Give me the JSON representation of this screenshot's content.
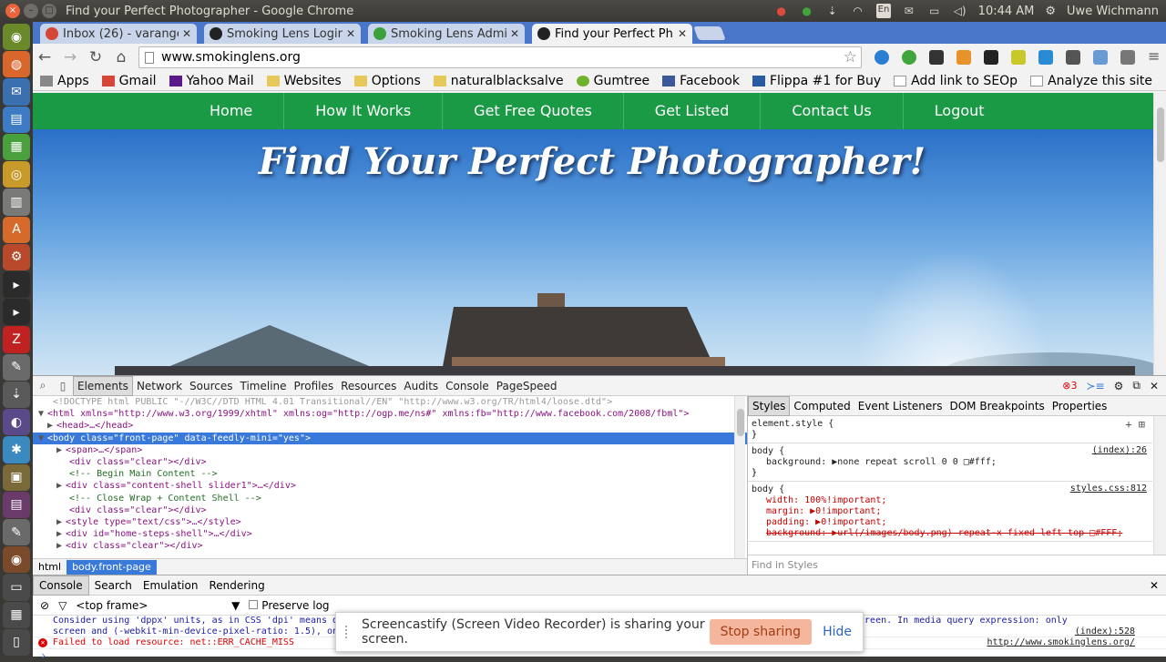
{
  "os": {
    "window_title": "Find your Perfect Photographer - Google Chrome",
    "time": "10:44 AM",
    "user": "Uwe Wichmann",
    "lang": "En"
  },
  "tabs": [
    {
      "label": "Inbox (26) - varange",
      "color": "#d44638"
    },
    {
      "label": "Smoking Lens Login",
      "color": "#222222"
    },
    {
      "label": "Smoking Lens Admi",
      "color": "#3ca03c"
    },
    {
      "label": "Find your Perfect Ph",
      "color": "#222222"
    }
  ],
  "toolbar": {
    "url": "www.smokinglens.org"
  },
  "bookmarks": [
    "Apps",
    "Gmail",
    "Yahoo Mail",
    "Websites",
    "Options",
    "naturalblacksalve",
    "Gumtree",
    "Facebook",
    "Flippa #1 for Buy",
    "Add link to SEOp",
    "Analyze this site"
  ],
  "site": {
    "nav": [
      "Home",
      "How It Works",
      "Get Free Quotes",
      "Get Listed",
      "Contact Us",
      "Logout"
    ],
    "hero_title": "Find Your Perfect Photographer!"
  },
  "devtools": {
    "tabs": [
      "Elements",
      "Network",
      "Sources",
      "Timeline",
      "Profiles",
      "Resources",
      "Audits",
      "Console",
      "PageSpeed"
    ],
    "error_count": "3",
    "dom_lines": [
      {
        "text": "<!DOCTYPE html PUBLIC \"-//W3C//DTD HTML 4.01 Transitional//EN\" \"http://www.w3.org/TR/html4/loose.dtd\">",
        "kind": "doctype",
        "tri": ""
      },
      {
        "text": "<html xmlns=\"http://www.w3.org/1999/xhtml\" xmlns:og=\"http://ogp.me/ns#\" xmlns:fb=\"http://www.facebook.com/2008/fbml\">",
        "kind": "tag",
        "tri": "▼"
      },
      {
        "text": "<head>…</head>",
        "kind": "tag",
        "tri": "▶"
      },
      {
        "text": "<body class=\"front-page\" data-feedly-mini=\"yes\">",
        "kind": "sel",
        "tri": "▼"
      },
      {
        "text": "<span>…</span>",
        "kind": "tag",
        "tri": "▶"
      },
      {
        "text": "<div class=\"clear\"></div>",
        "kind": "tag",
        "tri": ""
      },
      {
        "text": "<!-- Begin Main Content -->",
        "kind": "comment",
        "tri": ""
      },
      {
        "text": "<div class=\"content-shell slider1\">…</div>",
        "kind": "tag",
        "tri": "▶"
      },
      {
        "text": "<!-- Close Wrap + Content Shell -->",
        "kind": "comment",
        "tri": ""
      },
      {
        "text": "<div class=\"clear\"></div>",
        "kind": "tag",
        "tri": ""
      },
      {
        "text": "<style type=\"text/css\">…</style>",
        "kind": "tag",
        "tri": "▶"
      },
      {
        "text": "<div id=\"home-steps-shell\">…</div>",
        "kind": "tag",
        "tri": "▶"
      },
      {
        "text": "<div class=\"clear\"></div>",
        "kind": "tag",
        "tri": "▶"
      }
    ],
    "crumbs": [
      "html",
      "body.front-page"
    ],
    "style_tabs": [
      "Styles",
      "Computed",
      "Event Listeners",
      "DOM Breakpoints",
      "Properties"
    ],
    "style_rules": {
      "element_style": "element.style {",
      "rule1_sel": "body {",
      "rule1_src": "(index):26",
      "rule1_decl": "background: ▶none repeat scroll 0 0 □#fff;",
      "rule2_sel": "body {",
      "rule2_src": "styles.css:812",
      "rule2_decls": [
        "width: 100%!important;",
        "margin: ▶0!important;",
        "padding: ▶0!important;",
        "background: ▶url(/images/body.png) repeat-x fixed left top □#FFF;"
      ]
    },
    "styles_filter": "Find in Styles",
    "console_tabs": [
      "Console",
      "Search",
      "Emulation",
      "Rendering"
    ],
    "frame": "<top frame>",
    "preserve_log": "Preserve log",
    "messages": [
      {
        "text": "Consider using 'dppx' units, as in CSS 'dpi' means dots-per-CSS-inch, not dots-per-physical-inch, so does not correspond to the actual 'dpi' of a screen. In media query expression: only screen and (-webkit-min-device-pixel-ratio: 1.5), only screen and (min-resolution: 144dpi)",
        "loc": "(index):528",
        "type": "warn"
      },
      {
        "text": "Failed to load resource: net::ERR_CACHE_MISS",
        "loc": "http://www.smokinglens.org/",
        "type": "error"
      }
    ]
  },
  "screencast": {
    "message": "Screencastify (Screen Video Recorder) is sharing your screen.",
    "stop": "Stop sharing",
    "hide": "Hide"
  }
}
